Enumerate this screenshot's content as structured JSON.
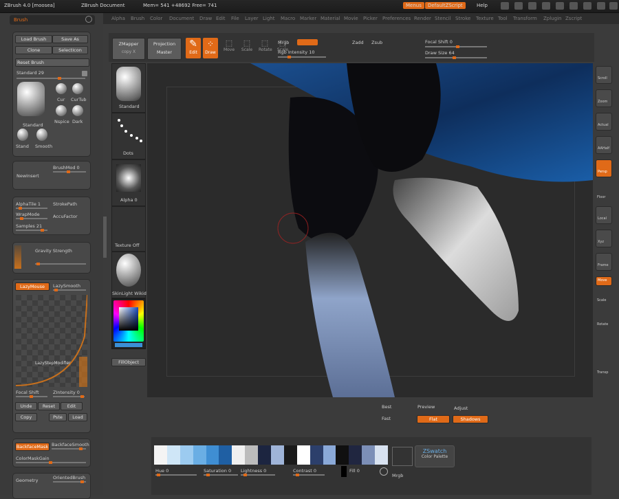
{
  "titlebar": {
    "app": "ZBrush 4.0 [moosea]",
    "doc": "ZBrush Document",
    "stats": "Mem= 541 +48692 Free= 741",
    "menus_btn": "Menus",
    "script": "DefaultZScript",
    "help": "Help"
  },
  "menubar": [
    "Alpha",
    "Brush",
    "Color",
    "Document",
    "Draw",
    "Edit",
    "File",
    "Layer",
    "Light",
    "Macro",
    "Marker",
    "Material",
    "Movie",
    "Picker",
    "Preferences",
    "Render",
    "Stencil",
    "Stroke",
    "Texture",
    "Tool",
    "Transform",
    "Zplugin",
    "Zscript"
  ],
  "brush_panel": {
    "title": "Brush",
    "load": "Load Brush",
    "save": "Save As",
    "clone": "Clone",
    "select": "SelectIcon",
    "reset": "Reset Brush",
    "standard": "Standard 29",
    "brush_names": [
      "Standard",
      "Cur",
      "CurTub",
      "Nspice",
      "Dark",
      "Stand",
      "Smooth"
    ],
    "brushmod": "BrushMod 0",
    "newinsert": "NewInsert",
    "alpha_tile": "AlphaTile 1",
    "stroke_path": "StrokePath",
    "wrapmode": "WrapMode",
    "accufactor": "AccuFactor",
    "samples": "Samples 21",
    "gravity": "Gravity Strength",
    "lazy": "LazyMouse",
    "lazysmooth": "LazySmooth",
    "curve_label": "LazyStepModifier",
    "focal": "Focal Shift",
    "strength": "ZIntensity 0",
    "edit_btns": [
      "Unde",
      "Reset",
      "Edit"
    ],
    "copy_btns": [
      "Copy",
      "Pste",
      "Load"
    ],
    "backface": "BackfaceMask",
    "backfacesmooth": "BackfaceSmooth",
    "color_mask": "ColorMaskGain",
    "geo_title": "Geometry",
    "orient": "OrientedBrush"
  },
  "tool_column": {
    "zmapper": "ZMapper",
    "zmapper_sub": "copy X",
    "projection": "Projection",
    "projection_sub": "Master",
    "brush_label": "Standard",
    "dots_label": "Dots",
    "alpha_label": "Alpha 0",
    "texture_label": "Texture Off",
    "material_label": "SkinLight Wikid",
    "fillobject": "FillObject"
  },
  "shelf": {
    "edit": "Edit",
    "draw": "Draw",
    "icons": [
      "Move",
      "Scale",
      "Rotate",
      "Scale"
    ],
    "mrgb": "Mrgb",
    "rgb_int": "Rgb Intensity 10",
    "zadd": "Zadd",
    "zsub": "Zsub",
    "focal_shift": "Focal Shift 0",
    "draw_size": "Draw Size 64"
  },
  "right_shelf": [
    "Scroll",
    "Zoom",
    "Actual",
    "AAHalf",
    "Persp",
    "Floor",
    "Local",
    "Xyz",
    "Frame",
    "Move",
    "Scale",
    "Rotate",
    "Transp"
  ],
  "render_section": {
    "best": "Best",
    "preview": "Preview",
    "adjust": "Adjust",
    "fast": "Fast",
    "flat": "Flat",
    "shadows": "Shadows"
  },
  "color_bar": {
    "hue": "Hue 0",
    "saturation": "Saturation 0",
    "lightness": "Lightness 0",
    "contrast": "Contrast 0",
    "fill": "Fill 0",
    "mrgb": "Mrgb",
    "zswatch": "ZSwatch",
    "palette": "Color Palette",
    "swatches": [
      "#f4f4f4",
      "#cfe6f7",
      "#9ccbf0",
      "#6aaee4",
      "#3f8ed3",
      "#1f5fa3",
      "#f0f0f0",
      "#bcbcbc",
      "#1c2540",
      "#9fb4d8",
      "#1a1a1a",
      "#ffffff",
      "#2c3f6b",
      "#8aa9d8",
      "#101010",
      "#202640",
      "#7c8fb7",
      "#d8e2f0"
    ]
  },
  "colors": {
    "accent": "#e06a18",
    "canvas": "#2c2c2c",
    "panel": "#484848"
  }
}
